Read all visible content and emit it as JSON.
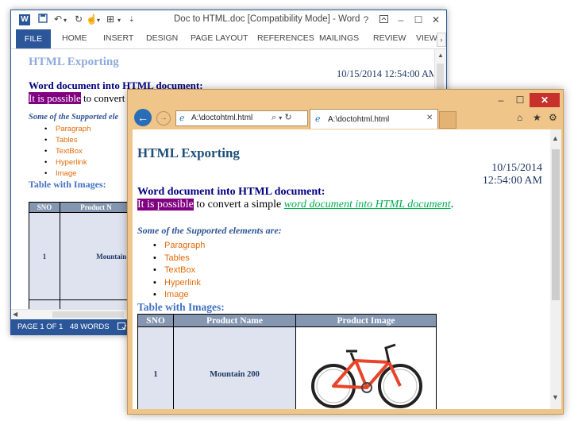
{
  "word": {
    "title": "Doc to HTML.doc [Compatibility Mode] - Word",
    "help": "?",
    "ribbon_tabs": [
      "FILE",
      "HOME",
      "INSERT",
      "DESIGN",
      "PAGE LAYOUT",
      "REFERENCES",
      "MAILINGS",
      "REVIEW",
      "VIEW"
    ],
    "status": {
      "page": "PAGE 1 OF 1",
      "words": "48 WORDS"
    },
    "doc": {
      "title": "HTML Exporting",
      "date": "10/15/2014 12:54:00 AM",
      "heading": "Word document into HTML document:",
      "highlight": "It is possible",
      "line_rest": " to convert a",
      "subheading": "Some of the Supported ele",
      "list": [
        "Paragraph",
        "Tables",
        "TextBox",
        "Hyperlink",
        "Image"
      ],
      "table_heading": "Table with Images:",
      "table_headers": [
        "SNO",
        "Product N"
      ],
      "row": {
        "sno": "1",
        "product": "Mountain 2"
      }
    }
  },
  "browser": {
    "address": "A:\\doctohtml.html",
    "tab_label": "A:\\doctohtml.html",
    "doc": {
      "title": "HTML Exporting",
      "date": "10/15/2014 12:54:00 AM",
      "heading": "Word document into HTML document:",
      "highlight": "It is possible",
      "line_mid": " to convert a simple ",
      "link": "word document into HTML document",
      "line_end": ".",
      "subheading": "Some of the Supported elements are:",
      "list": [
        "Paragraph",
        "Tables",
        "TextBox",
        "Hyperlink",
        "Image"
      ],
      "table_heading": "Table with Images:",
      "table_headers": [
        "SNO",
        "Product Name",
        "Product Image"
      ],
      "row": {
        "sno": "1",
        "product": "Mountain 200"
      }
    }
  },
  "colors": {
    "word_accent": "#2b579a",
    "ie_frame": "#f0c58a",
    "highlight": "#800080",
    "link": "#00b050",
    "list_text": "#e26b0a",
    "table_header": "#8496b0",
    "table_cell": "#dfe3ef",
    "bike_frame": "#e8442a"
  }
}
